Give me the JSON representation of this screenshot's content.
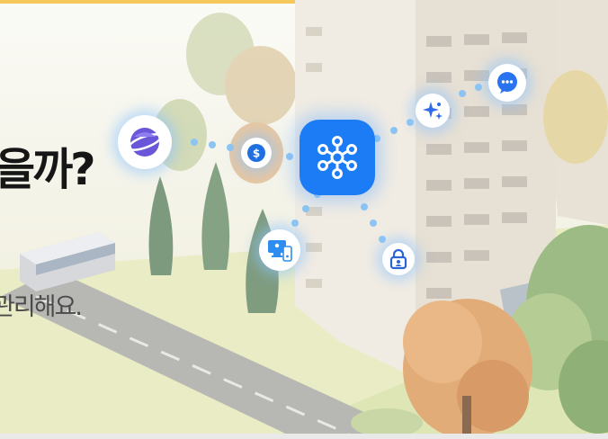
{
  "banner": {
    "headline": "을까?",
    "subline": "관리해요.",
    "colors": {
      "accent_bar": "#f6c85a",
      "hub_blue": "#1b7cf5",
      "dot_blue": "#8cc5f2"
    }
  },
  "icons": {
    "hub": "smartthings-hub-icon",
    "internet": "samsung-internet-icon",
    "pay": "samsung-pay-icon",
    "message": "chat-bubble-icon",
    "sparkle": "ai-sparkle-icon",
    "monitor": "monitor-device-icon",
    "security": "lock-security-icon"
  }
}
